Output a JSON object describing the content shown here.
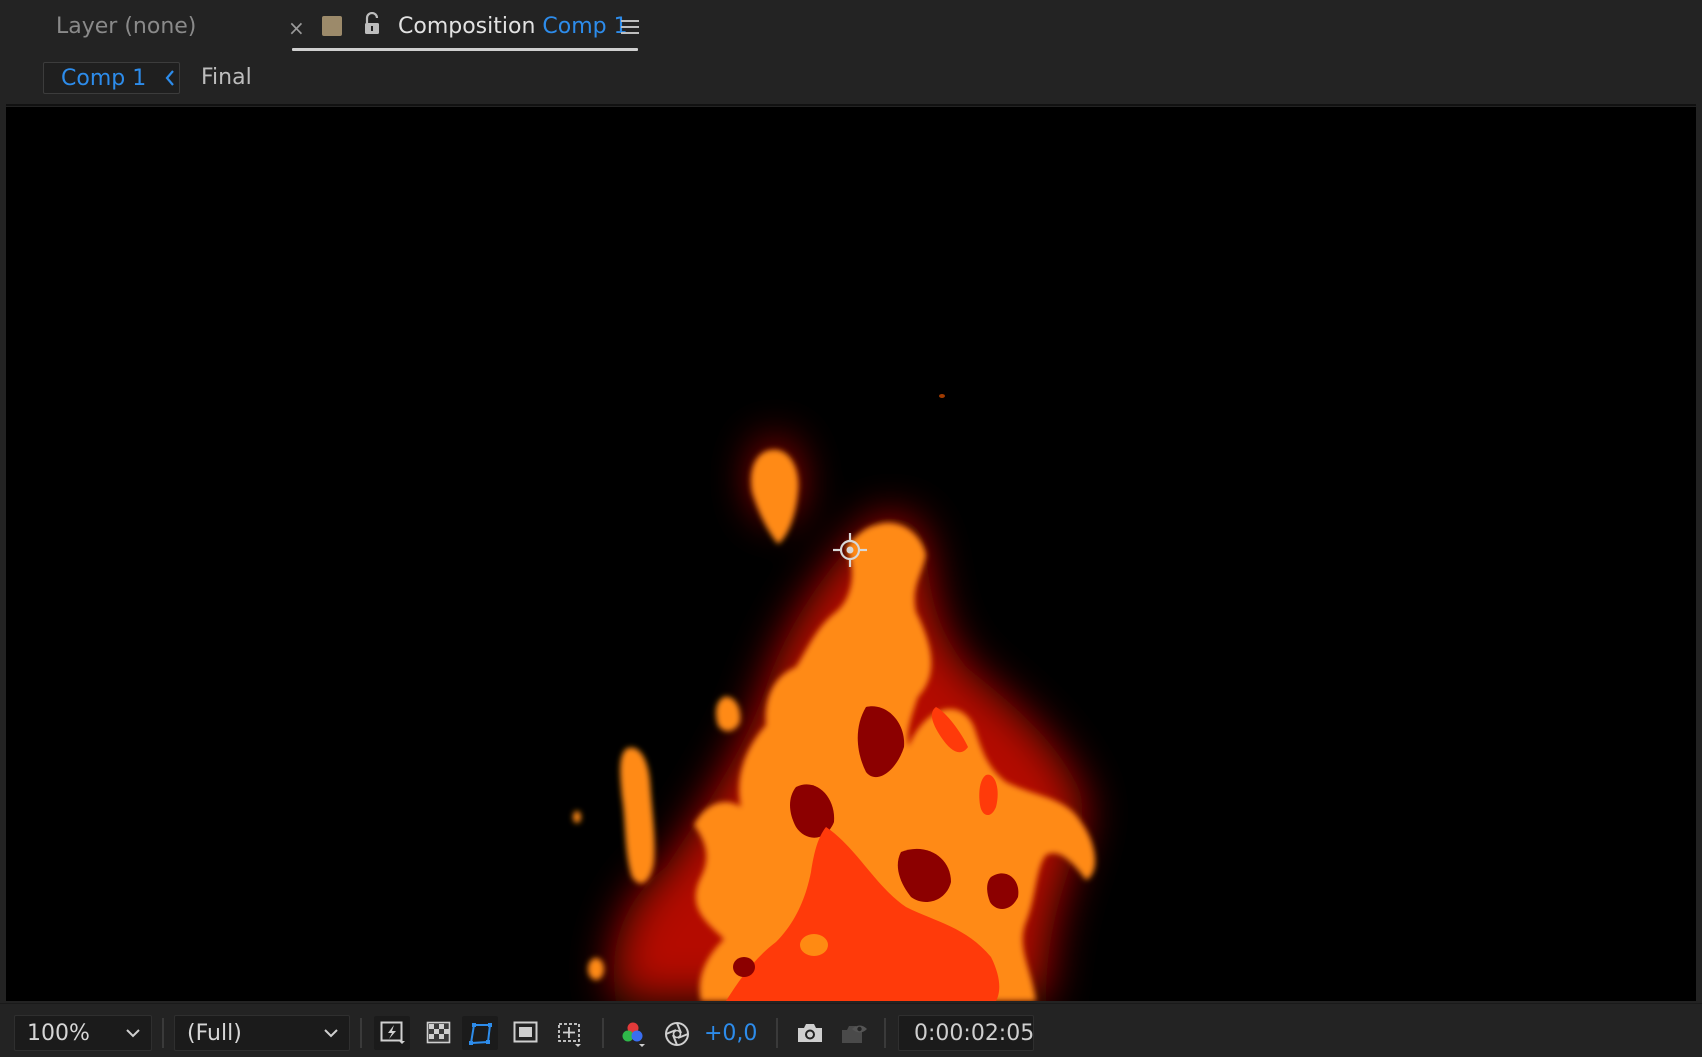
{
  "colors": {
    "accent": "#2d8ceb",
    "panel_bg": "#232323",
    "viewer_bg": "#000000",
    "label_swatch": "#9c8a6a",
    "fire_outer": "#ff8a12",
    "fire_core": "#ff3a0a",
    "fire_shadow": "#8c0000"
  },
  "tabs": {
    "layer_panel": "Layer (none)",
    "close_symbol": "×",
    "composition_prefix": "Composition",
    "composition_name": "Comp 1"
  },
  "breadcrumb": {
    "active": "Comp 1",
    "next": "Final"
  },
  "toolbar": {
    "magnification": "100%",
    "resolution": "(Full)",
    "exposure": "+0,0",
    "timecode": "0:00:02:05",
    "icons": [
      "fast-previews-icon",
      "transparency-grid-icon",
      "mask-path-visibility-icon",
      "region-of-interest-icon",
      "grid-guides-icon",
      "show-channel-icon",
      "reset-exposure-icon",
      "snapshot-camera-icon",
      "show-snapshot-icon"
    ]
  }
}
